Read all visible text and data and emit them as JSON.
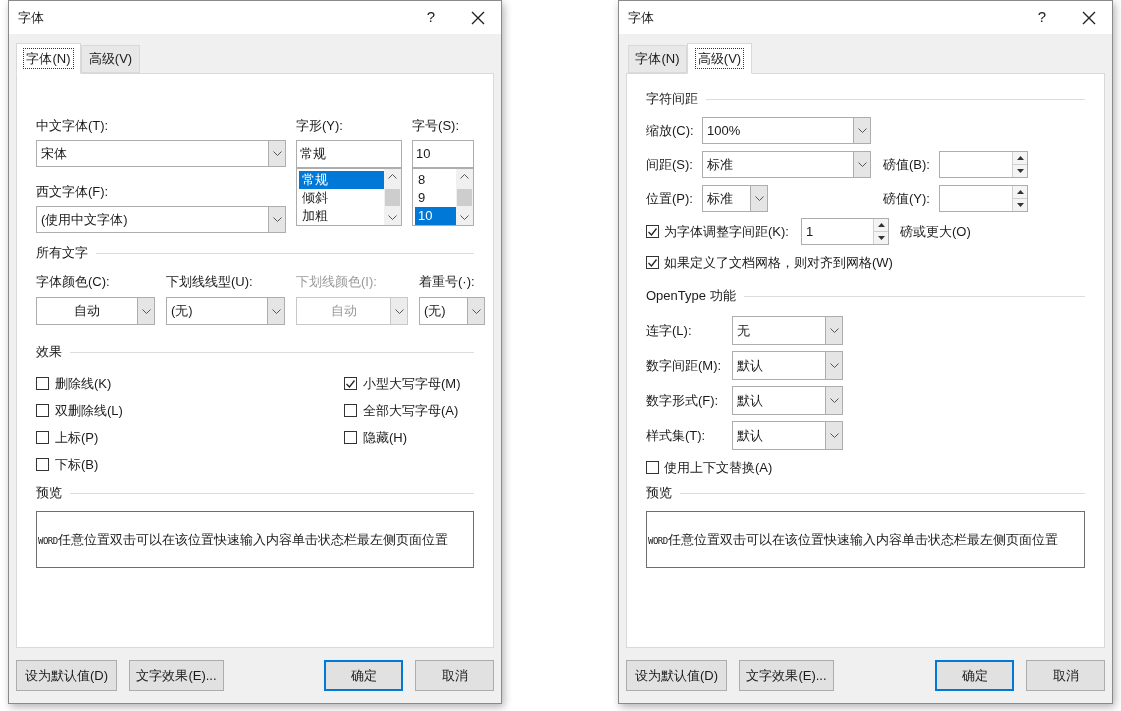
{
  "dialogs": [
    {
      "title": "字体",
      "help": "?",
      "tabs": [
        {
          "label": "字体(N)",
          "selected": true
        },
        {
          "label": "高级(V)",
          "selected": false
        }
      ],
      "font_page": {
        "chinese_font": {
          "label": "中文字体(T):",
          "value": "宋体"
        },
        "western_font": {
          "label": "西文字体(F):",
          "value": "(使用中文字体)"
        },
        "style": {
          "label": "字形(Y):",
          "value": "常规",
          "options": [
            {
              "label": "常规",
              "selected": true
            },
            {
              "label": "倾斜",
              "selected": false
            },
            {
              "label": "加粗",
              "selected": false
            }
          ]
        },
        "size": {
          "label": "字号(S):",
          "value": "10",
          "options": [
            {
              "label": "8",
              "selected": false
            },
            {
              "label": "9",
              "selected": false
            },
            {
              "label": "10",
              "selected": true
            }
          ]
        },
        "all_text": {
          "title": "所有文字",
          "fields": [
            {
              "label": "字体颜色(C):",
              "value": "自动",
              "kind": "color",
              "disabled": false
            },
            {
              "label": "下划线线型(U):",
              "value": "(无)",
              "kind": "list",
              "disabled": false
            },
            {
              "label": "下划线颜色(I):",
              "value": "自动",
              "kind": "color",
              "disabled": true
            },
            {
              "label": "着重号(·):",
              "value": "(无)",
              "kind": "list",
              "disabled": false
            }
          ]
        },
        "effects": {
          "title": "效果",
          "columns": [
            {
              "items": [
                {
                  "label": "删除线(K)",
                  "checked": false
                },
                {
                  "label": "双删除线(L)",
                  "checked": false
                },
                {
                  "label": "上标(P)",
                  "checked": false
                },
                {
                  "label": "下标(B)",
                  "checked": false
                }
              ]
            },
            {
              "items": [
                {
                  "label": "小型大写字母(M)",
                  "checked": true
                },
                {
                  "label": "全部大写字母(A)",
                  "checked": false
                },
                {
                  "label": "隐藏(H)",
                  "checked": false
                }
              ]
            }
          ]
        }
      },
      "preview": {
        "title": "预览",
        "latin": "WORD",
        "text": "任意位置双击可以在该位置快速输入内容单击状态栏最左侧页面位置"
      },
      "buttons": [
        {
          "label": "设为默认值(D)",
          "default": false
        },
        {
          "label": "文字效果(E)...",
          "default": false
        },
        {
          "label": "确定",
          "default": true
        },
        {
          "label": "取消",
          "default": false
        }
      ]
    },
    {
      "title": "字体",
      "help": "?",
      "tabs": [
        {
          "label": "字体(N)",
          "selected": false
        },
        {
          "label": "高级(V)",
          "selected": true
        }
      ],
      "advanced_page": {
        "sections": [
          {
            "title": "字符间距",
            "rows": [
              {
                "kind": "combo",
                "label": "缩放(C):",
                "value": "100%"
              },
              {
                "kind": "combo",
                "label": "间距(S):",
                "value": "标准",
                "spin": {
                  "label": "磅值(B):"
                }
              },
              {
                "kind": "short_combo",
                "label": "位置(P):",
                "value": "标准",
                "spin": {
                  "label": "磅值(Y):"
                }
              },
              {
                "kind": "check_spin",
                "label": "为字体调整字间距(K):",
                "checked": true,
                "value": "1",
                "unit": "磅或更大(O)"
              },
              {
                "kind": "check",
                "label": "如果定义了文档网格，则对齐到网格(W)",
                "checked": true
              }
            ]
          },
          {
            "title": "OpenType 功能",
            "rows": [
              {
                "kind": "feature_combo",
                "label": "连字(L):",
                "value": "无"
              },
              {
                "kind": "feature_combo",
                "label": "数字间距(M):",
                "value": "默认"
              },
              {
                "kind": "feature_combo",
                "label": "数字形式(F):",
                "value": "默认"
              },
              {
                "kind": "feature_combo",
                "label": "样式集(T):",
                "value": "默认"
              },
              {
                "kind": "check",
                "label": "使用上下文替换(A)",
                "checked": false
              }
            ]
          }
        ]
      },
      "preview": {
        "title": "预览",
        "latin": "WORD",
        "text": "任意位置双击可以在该位置快速输入内容单击状态栏最左侧页面位置"
      },
      "buttons": [
        {
          "label": "设为默认值(D)",
          "default": false
        },
        {
          "label": "文字效果(E)...",
          "default": false
        },
        {
          "label": "确定",
          "default": true
        },
        {
          "label": "取消",
          "default": false
        }
      ]
    }
  ]
}
